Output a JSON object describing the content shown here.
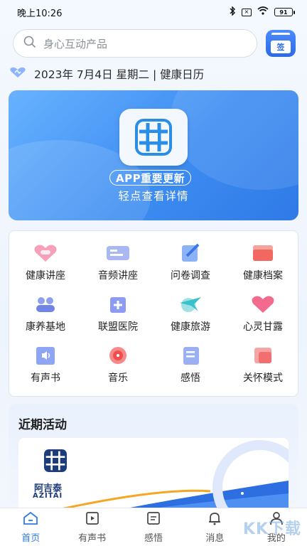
{
  "status_bar": {
    "time": "晚上10:26",
    "battery": "91"
  },
  "search": {
    "placeholder": "身心互动产品",
    "sign_label": "签"
  },
  "date_row": {
    "text": "2023年 7月4日 星期二 | 健康日历"
  },
  "banner": {
    "pill": "APP重要更新",
    "subtitle": "轻点查看详情"
  },
  "features": [
    {
      "label": "健康讲座",
      "icon": "heart-lecture-icon",
      "color": "#f47a9b"
    },
    {
      "label": "音频讲座",
      "icon": "audio-lecture-icon",
      "color": "#7d95e8"
    },
    {
      "label": "问卷调查",
      "icon": "survey-icon",
      "color": "#4a86f0"
    },
    {
      "label": "健康档案",
      "icon": "health-file-icon",
      "color": "#f2675f"
    },
    {
      "label": "康养基地",
      "icon": "wellness-base-icon",
      "color": "#6f86e6"
    },
    {
      "label": "联盟医院",
      "icon": "hospital-icon",
      "color": "#6d7ef0"
    },
    {
      "label": "健康旅游",
      "icon": "travel-icon",
      "color": "#35c2c9"
    },
    {
      "label": "心灵甘露",
      "icon": "heart-icon",
      "color": "#f36a8f"
    },
    {
      "label": "有声书",
      "icon": "audiobook-icon",
      "color": "#6b88ef"
    },
    {
      "label": "音乐",
      "icon": "music-icon",
      "color": "#ef4e4e"
    },
    {
      "label": "感悟",
      "icon": "reflection-icon",
      "color": "#6685ec"
    },
    {
      "label": "关怀模式",
      "icon": "care-mode-icon",
      "color": "#f36f6f"
    }
  ],
  "activity": {
    "title": "近期活动",
    "logo_text": "阿吉泰",
    "logo_sub": "AZITAI"
  },
  "bottom_nav": [
    {
      "label": "首页",
      "active": true
    },
    {
      "label": "有声书",
      "active": false
    },
    {
      "label": "感悟",
      "active": false
    },
    {
      "label": "消息",
      "active": false
    },
    {
      "label": "我的",
      "active": false
    }
  ],
  "watermark": "KK下载"
}
